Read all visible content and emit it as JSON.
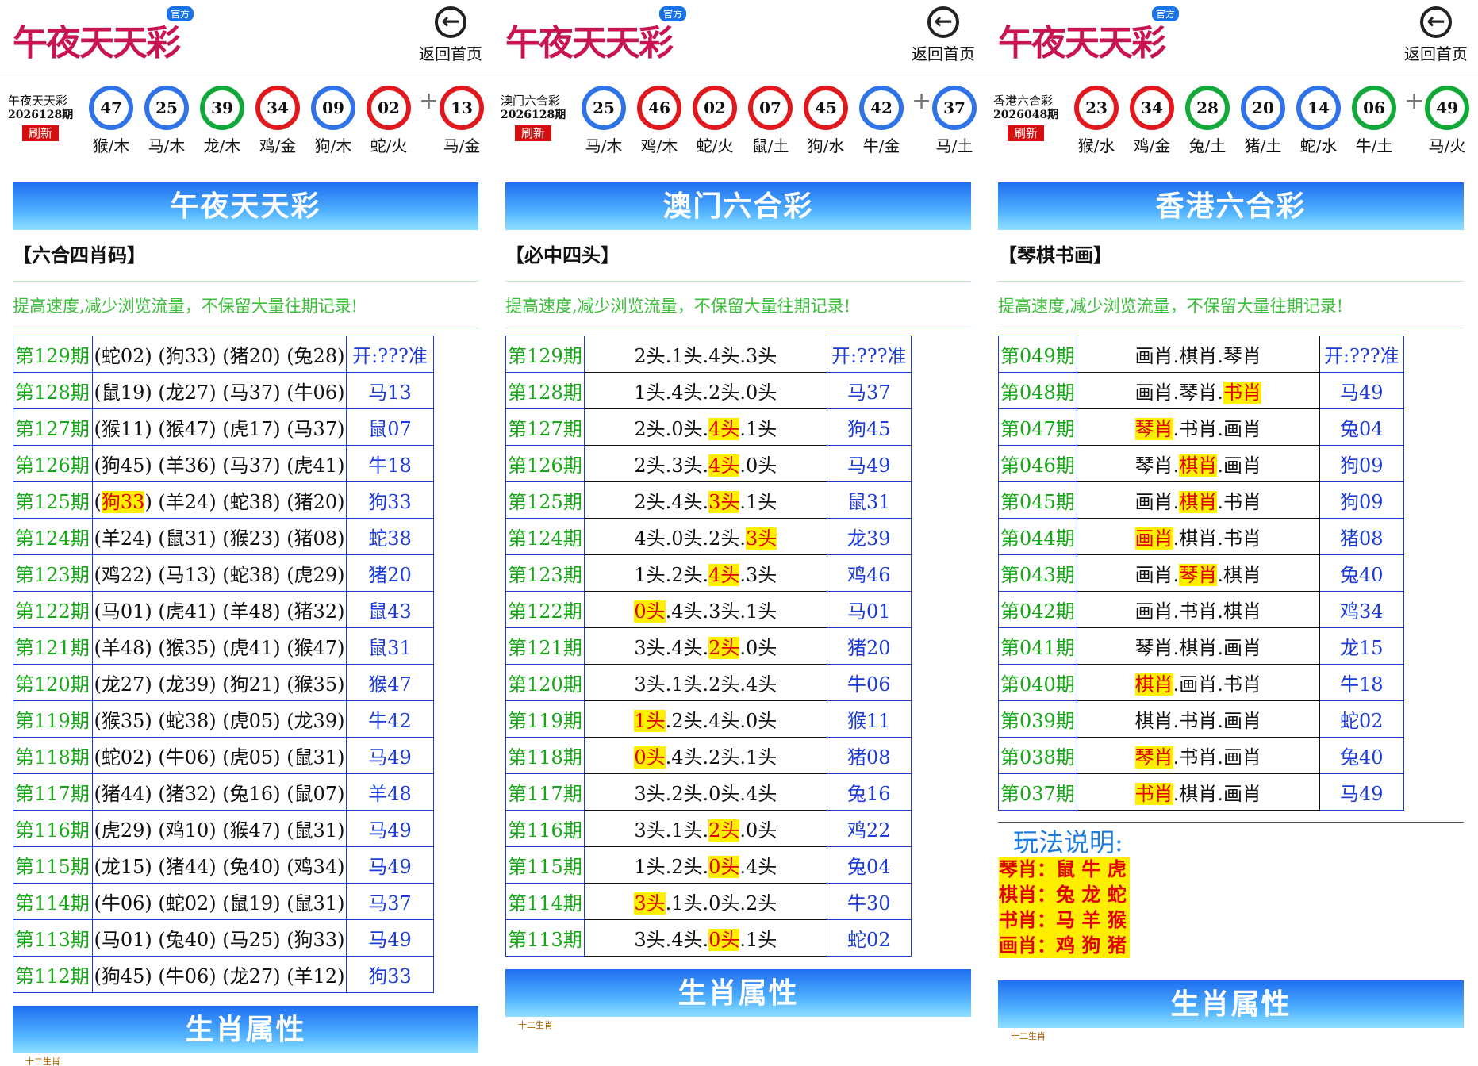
{
  "common": {
    "logo": "午夜天天彩",
    "badge": "官方",
    "back_label": "返回首页",
    "refresh_label": "刷新",
    "notice": "提高速度,减少浏览流量，不保留大量往期记录!",
    "zodiac_bar": "生肖属性",
    "zodiac_small": "十二生肖",
    "back_icon": "arrow-left-circle-icon"
  },
  "panels": [
    {
      "lottery": "午夜天天彩",
      "period": "2026128期",
      "section_title": "午夜天天彩",
      "subtitle": "【六合四肖码】",
      "balls": [
        {
          "n": "47",
          "z": "猴/木",
          "c": "blue"
        },
        {
          "n": "25",
          "z": "马/木",
          "c": "blue"
        },
        {
          "n": "39",
          "z": "龙/木",
          "c": "green"
        },
        {
          "n": "34",
          "z": "鸡/金",
          "c": "red"
        },
        {
          "n": "09",
          "z": "狗/木",
          "c": "blue"
        },
        {
          "n": "02",
          "z": "蛇/火",
          "c": "red"
        },
        {
          "n": "13",
          "z": "马/金",
          "c": "red"
        }
      ],
      "rows": [
        {
          "p": "第129期",
          "pred": "(蛇02) (狗33) (猪20) (兔28)",
          "res": "开:???准"
        },
        {
          "p": "第128期",
          "pred": "(鼠19) (龙27) (马37) (牛06)",
          "res": "马13"
        },
        {
          "p": "第127期",
          "pred": "(猴11) (猴47) (虎17) (马37)",
          "res": "鼠07"
        },
        {
          "p": "第126期",
          "pred": "(狗45) (羊36) (马37) (虎41)",
          "res": "牛18"
        },
        {
          "p": "第125期",
          "pred": "(狗33) (羊24) (蛇38) (猪20)",
          "res": "狗33",
          "hl": "狗33"
        },
        {
          "p": "第124期",
          "pred": "(羊24) (鼠31) (猴23) (猪08)",
          "res": "蛇38"
        },
        {
          "p": "第123期",
          "pred": "(鸡22) (马13) (蛇38) (虎29)",
          "res": "猪20"
        },
        {
          "p": "第122期",
          "pred": "(马01) (虎41) (羊48) (猪32)",
          "res": "鼠43"
        },
        {
          "p": "第121期",
          "pred": "(羊48) (猴35) (虎41) (猴47)",
          "res": "鼠31"
        },
        {
          "p": "第120期",
          "pred": "(龙27) (龙39) (狗21) (猴35)",
          "res": "猴47"
        },
        {
          "p": "第119期",
          "pred": "(猴35) (蛇38) (虎05) (龙39)",
          "res": "牛42"
        },
        {
          "p": "第118期",
          "pred": "(蛇02) (牛06) (虎05) (鼠31)",
          "res": "马49"
        },
        {
          "p": "第117期",
          "pred": "(猪44) (猪32) (兔16) (鼠07)",
          "res": "羊48"
        },
        {
          "p": "第116期",
          "pred": "(虎29) (鸡10) (猴47) (鼠31)",
          "res": "马49"
        },
        {
          "p": "第115期",
          "pred": "(龙15) (猪44) (兔40) (鸡34)",
          "res": "马49"
        },
        {
          "p": "第114期",
          "pred": "(牛06) (蛇02) (鼠19) (鼠31)",
          "res": "马37"
        },
        {
          "p": "第113期",
          "pred": "(马01) (兔40) (马25) (狗33)",
          "res": "马49"
        },
        {
          "p": "第112期",
          "pred": "(狗45) (牛06) (龙27) (羊12)",
          "res": "狗33"
        }
      ]
    },
    {
      "lottery": "澳门六合彩",
      "period": "2026128期",
      "section_title": "澳门六合彩",
      "subtitle": "【必中四头】",
      "balls": [
        {
          "n": "25",
          "z": "马/木",
          "c": "blue"
        },
        {
          "n": "46",
          "z": "鸡/木",
          "c": "red"
        },
        {
          "n": "02",
          "z": "蛇/火",
          "c": "red"
        },
        {
          "n": "07",
          "z": "鼠/土",
          "c": "red"
        },
        {
          "n": "45",
          "z": "狗/水",
          "c": "red"
        },
        {
          "n": "42",
          "z": "牛/金",
          "c": "blue"
        },
        {
          "n": "37",
          "z": "马/土",
          "c": "blue"
        }
      ],
      "rows": [
        {
          "p": "第129期",
          "parts": [
            "2头.",
            "1头.",
            "4头.",
            "3头"
          ],
          "h": -1,
          "res": "开:???准"
        },
        {
          "p": "第128期",
          "parts": [
            "1头.",
            "4头.",
            "2头.",
            "0头"
          ],
          "h": -1,
          "res": "马37"
        },
        {
          "p": "第127期",
          "parts": [
            "2头.",
            "0头.",
            "4头",
            ".1头"
          ],
          "h": 2,
          "res": "狗45"
        },
        {
          "p": "第126期",
          "parts": [
            "2头.",
            "3头.",
            "4头",
            ".0头"
          ],
          "h": 2,
          "res": "马49"
        },
        {
          "p": "第125期",
          "parts": [
            "2头.",
            "4头.",
            "3头",
            ".1头"
          ],
          "h": 2,
          "res": "鼠31"
        },
        {
          "p": "第124期",
          "parts": [
            "4头.",
            "0头.",
            "2头.",
            "3头"
          ],
          "h": 3,
          "res": "龙39"
        },
        {
          "p": "第123期",
          "parts": [
            "1头.",
            "2头.",
            "4头",
            ".3头"
          ],
          "h": 2,
          "res": "鸡46"
        },
        {
          "p": "第122期",
          "parts": [
            "0头",
            ".4头.",
            "3头.",
            "1头"
          ],
          "h": 0,
          "res": "马01"
        },
        {
          "p": "第121期",
          "parts": [
            "3头.",
            "4头.",
            "2头",
            ".0头"
          ],
          "h": 2,
          "res": "猪20"
        },
        {
          "p": "第120期",
          "parts": [
            "3头.",
            "1头.",
            "2头.",
            "4头"
          ],
          "h": -1,
          "res": "牛06"
        },
        {
          "p": "第119期",
          "parts": [
            "1头",
            ".2头.",
            "4头.",
            "0头"
          ],
          "h": 0,
          "res": "猴11"
        },
        {
          "p": "第118期",
          "parts": [
            "0头",
            ".4头.",
            "2头.",
            "1头"
          ],
          "h": 0,
          "res": "猪08"
        },
        {
          "p": "第117期",
          "parts": [
            "3头.",
            "2头.",
            "0头.",
            "4头"
          ],
          "h": -1,
          "res": "兔16"
        },
        {
          "p": "第116期",
          "parts": [
            "3头.",
            "1头.",
            "2头",
            ".0头"
          ],
          "h": 2,
          "res": "鸡22"
        },
        {
          "p": "第115期",
          "parts": [
            "1头.",
            "2头.",
            "0头",
            ".4头"
          ],
          "h": 2,
          "res": "兔04"
        },
        {
          "p": "第114期",
          "parts": [
            "3头",
            ".1头.",
            "0头.",
            "2头"
          ],
          "h": 0,
          "res": "牛30"
        },
        {
          "p": "第113期",
          "parts": [
            "3头.",
            "4头.",
            "0头",
            ".1头"
          ],
          "h": 2,
          "res": "蛇02"
        }
      ]
    },
    {
      "lottery": "香港六合彩",
      "period": "2026048期",
      "section_title": "香港六合彩",
      "subtitle": "【琴棋书画】",
      "balls": [
        {
          "n": "23",
          "z": "猴/水",
          "c": "red"
        },
        {
          "n": "34",
          "z": "鸡/金",
          "c": "red"
        },
        {
          "n": "28",
          "z": "兔/土",
          "c": "green"
        },
        {
          "n": "20",
          "z": "猪/土",
          "c": "blue"
        },
        {
          "n": "14",
          "z": "蛇/水",
          "c": "blue"
        },
        {
          "n": "06",
          "z": "牛/土",
          "c": "green"
        },
        {
          "n": "49",
          "z": "马/火",
          "c": "green"
        }
      ],
      "rows": [
        {
          "p": "第049期",
          "parts": [
            "画肖.",
            "棋肖.",
            "琴肖"
          ],
          "h": -1,
          "res": "开:???准"
        },
        {
          "p": "第048期",
          "parts": [
            "画肖.",
            "琴肖.",
            "书肖"
          ],
          "h": 2,
          "res": "马49"
        },
        {
          "p": "第047期",
          "parts": [
            "琴肖",
            ".书肖.",
            "画肖"
          ],
          "h": 0,
          "res": "兔04"
        },
        {
          "p": "第046期",
          "parts": [
            "琴肖.",
            "棋肖",
            ".画肖"
          ],
          "h": 1,
          "res": "狗09"
        },
        {
          "p": "第045期",
          "parts": [
            "画肖.",
            "棋肖",
            ".书肖"
          ],
          "h": 1,
          "res": "狗09"
        },
        {
          "p": "第044期",
          "parts": [
            "画肖",
            ".棋肖.",
            "书肖"
          ],
          "h": 0,
          "res": "猪08"
        },
        {
          "p": "第043期",
          "parts": [
            "画肖.",
            "琴肖",
            ".棋肖"
          ],
          "h": 1,
          "res": "兔40"
        },
        {
          "p": "第042期",
          "parts": [
            "画肖.",
            "书肖.",
            "棋肖"
          ],
          "h": -1,
          "res": "鸡34"
        },
        {
          "p": "第041期",
          "parts": [
            "琴肖.",
            "棋肖.",
            "画肖"
          ],
          "h": -1,
          "res": "龙15"
        },
        {
          "p": "第040期",
          "parts": [
            "棋肖",
            ".画肖.",
            "书肖"
          ],
          "h": 0,
          "res": "牛18"
        },
        {
          "p": "第039期",
          "parts": [
            "棋肖.",
            "书肖.",
            "画肖"
          ],
          "h": -1,
          "res": "蛇02"
        },
        {
          "p": "第038期",
          "parts": [
            "琴肖",
            ".书肖.",
            "画肖"
          ],
          "h": 0,
          "res": "兔40"
        },
        {
          "p": "第037期",
          "parts": [
            "书肖",
            ".棋肖.",
            "画肖"
          ],
          "h": 0,
          "res": "马49"
        }
      ]
    }
  ],
  "rules": {
    "title": "玩法说明:",
    "items": [
      "琴肖：鼠 牛 虎",
      "棋肖：兔 龙 蛇",
      "书肖：马 羊 猴",
      "画肖：鸡 狗 猪"
    ]
  }
}
